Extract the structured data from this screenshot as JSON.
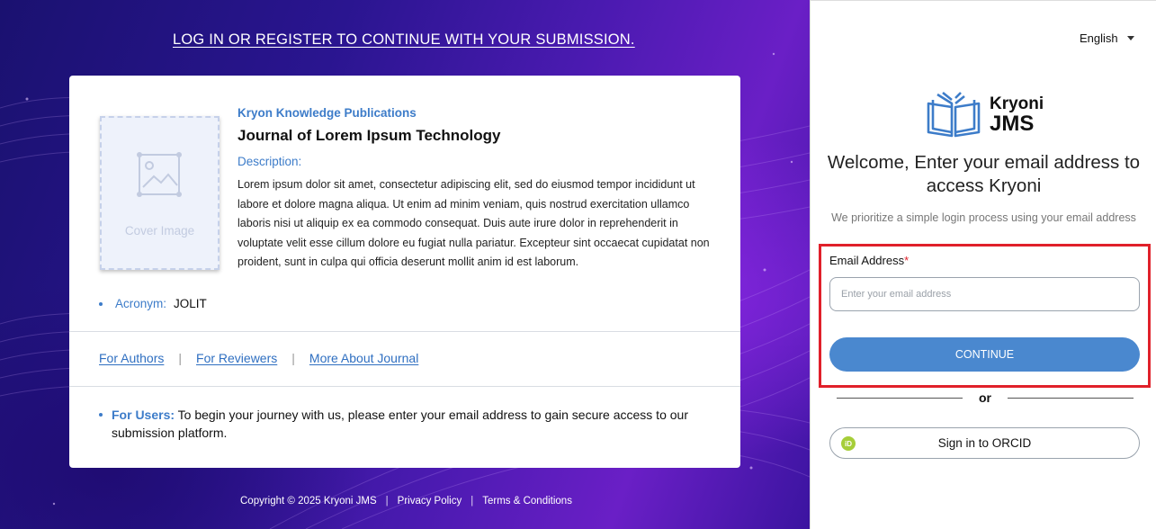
{
  "page": {
    "top_link": "LOG IN OR REGISTER TO CONTINUE WITH YOUR SUBMISSION."
  },
  "journal": {
    "cover_label": "Cover Image",
    "publisher": "Kryon Knowledge Publications",
    "title": "Journal of Lorem Ipsum Technology",
    "description_label": "Description:",
    "description": "Lorem ipsum dolor sit amet, consectetur adipiscing elit, sed do eiusmod tempor incididunt ut labore et dolore magna aliqua. Ut enim ad minim veniam, quis nostrud exercitation ullamco laboris nisi ut aliquip ex ea commodo consequat. Duis aute irure dolor in reprehenderit in voluptate velit esse cillum dolore eu fugiat nulla pariatur. Excepteur sint occaecat cupidatat non proident, sunt in culpa qui officia deserunt mollit anim id est laborum.",
    "acronym_label": "Acronym:",
    "acronym_value": "JOLIT",
    "links": [
      "For Authors",
      "For Reviewers",
      "More About Journal"
    ],
    "users_label": "For Users:",
    "users_text": " To begin your journey with us, please enter your email address to gain secure access to our submission platform."
  },
  "footer": {
    "copyright": "Copyright © 2025 Kryoni JMS",
    "privacy": "Privacy Policy",
    "terms": "Terms & Conditions"
  },
  "login": {
    "language": "English",
    "logo_line1": "Kryoni",
    "logo_line2": "JMS",
    "welcome": "Welcome, Enter your email address to access Kryoni",
    "subtitle": "We prioritize a simple login process using your email address",
    "email_label": "Email Address",
    "email_required_mark": "*",
    "email_placeholder": "Enter your email address",
    "email_value": "",
    "continue_label": "CONTINUE",
    "or_label": "or",
    "orcid_label": "Sign in to ORCID",
    "orcid_icon_text": "iD"
  },
  "colors": {
    "accent": "#4a88cf",
    "link": "#3d7cc9",
    "highlight": "#e0202a",
    "orcid": "#a6ce39"
  },
  "icons": {
    "cover": "image-placeholder-icon",
    "logo": "open-book-icon",
    "language": "caret-down-icon",
    "orcid": "orcid-icon"
  }
}
